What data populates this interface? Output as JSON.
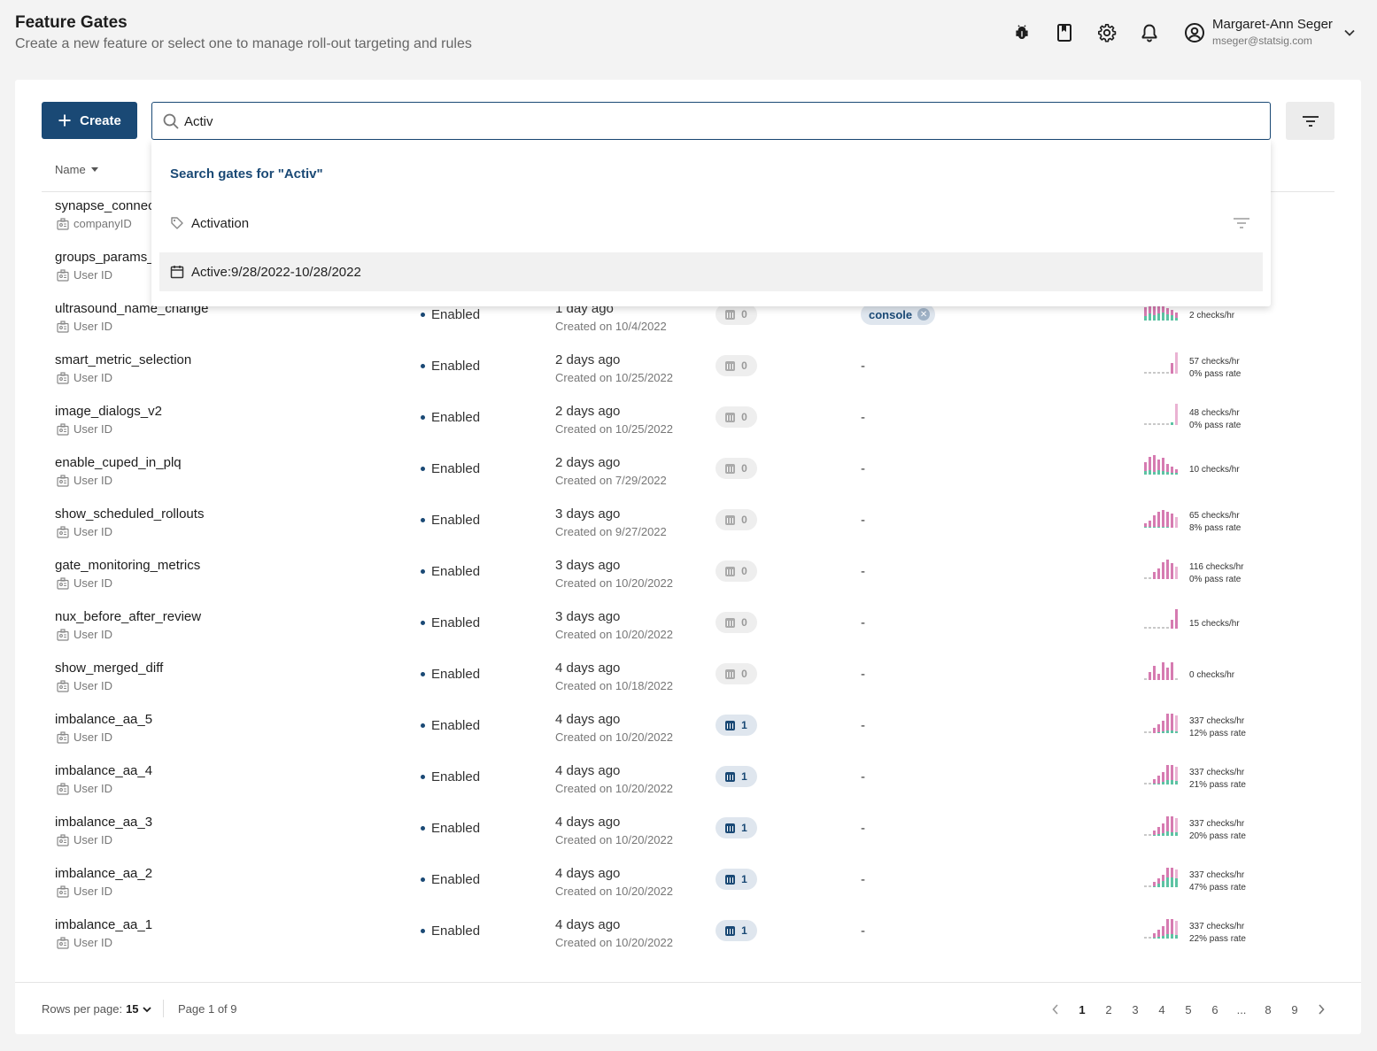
{
  "header": {
    "title": "Feature Gates",
    "subtitle": "Create a new feature or select one to manage roll-out targeting and rules",
    "icons": [
      "bug-icon",
      "book-icon",
      "gear-icon",
      "bell-icon"
    ],
    "user": {
      "name": "Margaret-Ann Seger",
      "email": "mseger@statsig.com"
    }
  },
  "toolbar": {
    "create_label": "Create",
    "search_value": "Activ"
  },
  "table": {
    "name_header": "Name"
  },
  "dropdown": {
    "search_prompt": "Search gates for \"Activ\"",
    "options": [
      {
        "label": "Activation",
        "icon": "tag-icon"
      },
      {
        "label": "Active:9/28/2022-10/28/2022",
        "icon": "calendar-icon"
      }
    ]
  },
  "rows": [
    {
      "name": "synapse_connec",
      "id_type": "companyID"
    },
    {
      "name": "groups_params_",
      "id_type": "User ID"
    },
    {
      "name": "ultrasound_name_change",
      "id_type": "User ID",
      "status": "Enabled",
      "updated": "1 day ago",
      "created": "Created on 10/4/2022",
      "count": "0",
      "tag": "console",
      "checks": "2 checks/hr",
      "pass": ""
    },
    {
      "name": "smart_metric_selection",
      "id_type": "User ID",
      "status": "Enabled",
      "updated": "2 days ago",
      "created": "Created on 10/25/2022",
      "count": "0",
      "tags": "-",
      "checks": "57 checks/hr",
      "pass": "0% pass rate"
    },
    {
      "name": "image_dialogs_v2",
      "id_type": "User ID",
      "status": "Enabled",
      "updated": "2 days ago",
      "created": "Created on 10/25/2022",
      "count": "0",
      "tags": "-",
      "checks": "48 checks/hr",
      "pass": "0% pass rate"
    },
    {
      "name": "enable_cuped_in_plq",
      "id_type": "User ID",
      "status": "Enabled",
      "updated": "2 days ago",
      "created": "Created on 7/29/2022",
      "count": "0",
      "tags": "-",
      "checks": "10 checks/hr",
      "pass": ""
    },
    {
      "name": "show_scheduled_rollouts",
      "id_type": "User ID",
      "status": "Enabled",
      "updated": "3 days ago",
      "created": "Created on 9/27/2022",
      "count": "0",
      "tags": "-",
      "checks": "65 checks/hr",
      "pass": "8% pass rate"
    },
    {
      "name": "gate_monitoring_metrics",
      "id_type": "User ID",
      "status": "Enabled",
      "updated": "3 days ago",
      "created": "Created on 10/20/2022",
      "count": "0",
      "tags": "-",
      "checks": "116 checks/hr",
      "pass": "0% pass rate"
    },
    {
      "name": "nux_before_after_review",
      "id_type": "User ID",
      "status": "Enabled",
      "updated": "3 days ago",
      "created": "Created on 10/20/2022",
      "count": "0",
      "tags": "-",
      "checks": "15 checks/hr",
      "pass": ""
    },
    {
      "name": "show_merged_diff",
      "id_type": "User ID",
      "status": "Enabled",
      "updated": "4 days ago",
      "created": "Created on 10/18/2022",
      "count": "0",
      "tags": "-",
      "checks": "0 checks/hr",
      "pass": ""
    },
    {
      "name": "imbalance_aa_5",
      "id_type": "User ID",
      "status": "Enabled",
      "updated": "4 days ago",
      "created": "Created on 10/20/2022",
      "count": "1",
      "tags": "-",
      "checks": "337 checks/hr",
      "pass": "12% pass rate"
    },
    {
      "name": "imbalance_aa_4",
      "id_type": "User ID",
      "status": "Enabled",
      "updated": "4 days ago",
      "created": "Created on 10/20/2022",
      "count": "1",
      "tags": "-",
      "checks": "337 checks/hr",
      "pass": "21% pass rate"
    },
    {
      "name": "imbalance_aa_3",
      "id_type": "User ID",
      "status": "Enabled",
      "updated": "4 days ago",
      "created": "Created on 10/20/2022",
      "count": "1",
      "tags": "-",
      "checks": "337 checks/hr",
      "pass": "20% pass rate"
    },
    {
      "name": "imbalance_aa_2",
      "id_type": "User ID",
      "status": "Enabled",
      "updated": "4 days ago",
      "created": "Created on 10/20/2022",
      "count": "1",
      "tags": "-",
      "checks": "337 checks/hr",
      "pass": "47% pass rate"
    },
    {
      "name": "imbalance_aa_1",
      "id_type": "User ID",
      "status": "Enabled",
      "updated": "4 days ago",
      "created": "Created on 10/20/2022",
      "count": "1",
      "tags": "-",
      "checks": "337 checks/hr",
      "pass": "22% pass rate"
    }
  ],
  "footer": {
    "rows_per_page_label": "Rows per page:",
    "rows_per_page_value": "15",
    "page_of": "Page 1 of 9",
    "pages": [
      "1",
      "2",
      "3",
      "4",
      "5",
      "6",
      "...",
      "8",
      "9"
    ],
    "active_page": "1"
  },
  "colors": {
    "accent": "#1a4975",
    "spark_pink": "#d67bb1",
    "spark_teal": "#5cc3a3",
    "spark_grey": "#c9c9c9"
  }
}
